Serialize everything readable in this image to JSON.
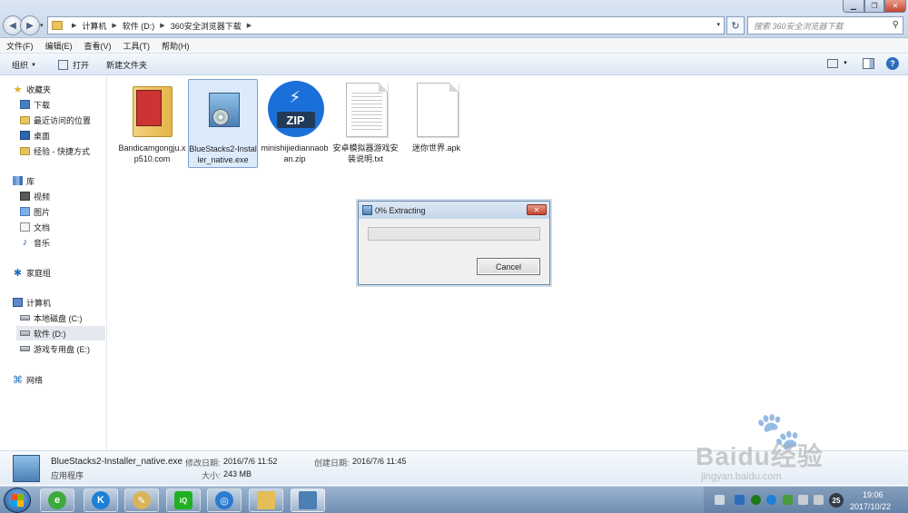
{
  "window": {
    "breadcrumb": [
      "计算机",
      "软件 (D:)",
      "360安全浏览器下载"
    ],
    "search_placeholder": "搜索 360安全浏览器下载"
  },
  "menu": [
    "文件(F)",
    "编辑(E)",
    "查看(V)",
    "工具(T)",
    "帮助(H)"
  ],
  "toolbar": {
    "organize_label": "组织",
    "open_label": "打开",
    "new_folder_label": "新建文件夹"
  },
  "sidebar": {
    "favorites": {
      "label": "收藏夹",
      "items": [
        "下载",
        "最近访问的位置",
        "桌面",
        "经验 - 快捷方式"
      ]
    },
    "libraries": {
      "label": "库",
      "items": [
        "视频",
        "图片",
        "文档",
        "音乐"
      ]
    },
    "homegroup": "家庭组",
    "computer": {
      "label": "计算机",
      "items": [
        "本地磁盘 (C:)",
        "软件 (D:)",
        "游戏专用盘 (E:)"
      ],
      "selected": "软件 (D:)"
    },
    "network": "网络"
  },
  "files": [
    {
      "name": "Bandicamgongju.xp510.com",
      "type": "folder",
      "selected": false
    },
    {
      "name": "BlueStacks2-Installer_native.exe",
      "type": "installer",
      "selected": true
    },
    {
      "name": "minishijiediannaoban.zip",
      "type": "zip",
      "selected": false
    },
    {
      "name": "安卓模拟器游戏安装说明.txt",
      "type": "txt",
      "selected": false
    },
    {
      "name": "迷你世界.apk",
      "type": "blank",
      "selected": false
    }
  ],
  "dialog": {
    "title": "0% Extracting",
    "progress": 0,
    "cancel_label": "Cancel"
  },
  "details": {
    "name": "BlueStacks2-Installer_native.exe",
    "type": "应用程序",
    "modified_label": "修改日期:",
    "modified_value": "2016/7/6 11:52",
    "size_label": "大小:",
    "size_value": "243 MB",
    "created_label": "创建日期:",
    "created_value": "2016/7/6 11:45"
  },
  "taskbar": {
    "time": "19:06",
    "date": "2017/10/22",
    "tray_badge": "25"
  },
  "watermark": {
    "brand": "Baidu经验",
    "url": "jingyan.baidu.com"
  }
}
